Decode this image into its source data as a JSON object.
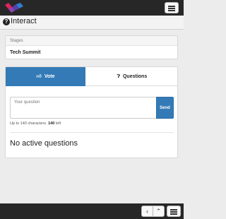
{
  "colors": {
    "accent": "#337ab7",
    "bar": "#272727"
  },
  "topbar": {
    "logo_icon": "brand-logo-icon",
    "menu_icon": "hamburger-menu-icon"
  },
  "header": {
    "title": "Interact",
    "icon": "question-circle-icon"
  },
  "stage": {
    "label": "Stages",
    "name": "Tech Summit"
  },
  "tabs": [
    {
      "label": "Vote",
      "icon": "thumbs-up-icon",
      "active": true
    },
    {
      "label": "Questions",
      "icon": "question-circle-icon",
      "active": false
    }
  ],
  "question_form": {
    "placeholder": "Your question",
    "value": "",
    "send_label": "Send",
    "hint_prefix": "Up to 140 characters.",
    "remaining": "140",
    "hint_suffix": "left"
  },
  "empty_state": "No active questions",
  "bottombar": {
    "prev_glyph": "‹",
    "up_glyph": "⌃",
    "prev_icon": "chevron-left-icon",
    "up_icon": "chevron-up-icon",
    "menu_icon": "hamburger-menu-icon"
  }
}
